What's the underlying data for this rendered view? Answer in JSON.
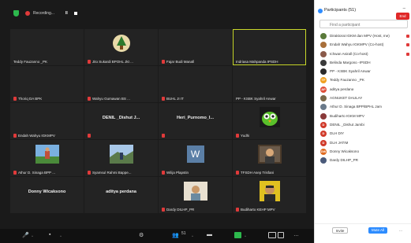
{
  "topbar": {
    "recording_label": "Recording...",
    "pause_label": "II"
  },
  "tiles": [
    {
      "name": "Teddy Fauzanno _PK",
      "mic_muted": false,
      "center": ""
    },
    {
      "name": "Jito Sukardi BPOHL Jkt ...",
      "mic_muted": true,
      "center": ""
    },
    {
      "name": "Fajar Budi Manafi",
      "mic_muted": true,
      "center": ""
    },
    {
      "name": "Indriasa Mahpanda IPSDH",
      "mic_muted": false,
      "center": ""
    },
    {
      "name": "Thoriq DA BPK",
      "mic_muted": true,
      "center": ""
    },
    {
      "name": "Wahyu Gumawan BS ...",
      "mic_muted": true,
      "center": ""
    },
    {
      "name": "BUHL JI IT",
      "mic_muted": true,
      "center": ""
    },
    {
      "name": "PP - KSBK Syahril Anwar",
      "mic_muted": false,
      "center": ""
    },
    {
      "name": "Endah Wahyu IGKMPV",
      "mic_muted": true,
      "center": ""
    },
    {
      "name": "",
      "mic_muted": true,
      "center": "DENIL _Dishut J..."
    },
    {
      "name": "",
      "mic_muted": true,
      "center": "Heri_Purnomo_I..."
    },
    {
      "name": "Yudhi",
      "mic_muted": true,
      "center": ""
    },
    {
      "name": "Athur D. Sinaga BPP ...",
      "mic_muted": true,
      "center": ""
    },
    {
      "name": "Syamsul Rahmi Bappe...",
      "mic_muted": true,
      "center": ""
    },
    {
      "name": "Wilija Plapstin",
      "mic_muted": true,
      "center": ""
    },
    {
      "name": "TFSDH Asep Trisfani",
      "mic_muted": true,
      "center": ""
    },
    {
      "name": "",
      "mic_muted": false,
      "center": "Donny Wicaksono"
    },
    {
      "name": "",
      "mic_muted": false,
      "center": "aditya perdana"
    },
    {
      "name": "Dardy DILHP_PR",
      "mic_muted": true,
      "center": ""
    },
    {
      "name": "Budiharto KEHP MPV",
      "mic_muted": true,
      "center": ""
    }
  ],
  "w_avatar": "W",
  "bottombar": {
    "participants_count": "51"
  },
  "panel": {
    "title": "Participants (51)",
    "search_placeholder": "Find a participant",
    "participants": [
      {
        "name": "Diraktorat IGKM dan MPV (Host, me)",
        "color": "#5a7a3a",
        "initial": ""
      },
      {
        "name": "Endah Wahyu IGKMPV (Co-host)",
        "color": "#a86f3a",
        "initial": ""
      },
      {
        "name": "Ichwan Asirall (Co-host)",
        "color": "#8a5a4a",
        "initial": ""
      },
      {
        "name": "Belinda Margono -IPSDH",
        "color": "#3a3a3a",
        "initial": ""
      },
      {
        "name": "PP - KSBK Syahril Anwar",
        "color": "#2a2a2a",
        "initial": ""
      },
      {
        "name": "Teddy Fauzanno _PK",
        "color": "#f0a020",
        "initial": "TF"
      },
      {
        "name": "aditya perdana",
        "color": "#e0503a",
        "initial": "AP"
      },
      {
        "name": "AGNUKET DAULAY",
        "color": "#7a6a4a",
        "initial": ""
      },
      {
        "name": "Athur D. Sinaga BPP/BPHL Jam",
        "color": "#6a7a8a",
        "initial": ""
      },
      {
        "name": "Budiharto IGKM MPV",
        "color": "#8a3a3a",
        "initial": ""
      },
      {
        "name": "DENIL _Dishut Jambi",
        "color": "#d03a2a",
        "initial": "D"
      },
      {
        "name": "DLH DIY",
        "color": "#d03a2a",
        "initial": "D"
      },
      {
        "name": "DLH JATIM",
        "color": "#d03a2a",
        "initial": "D"
      },
      {
        "name": "Donny Wicaksono",
        "color": "#e06a20",
        "initial": "DW"
      },
      {
        "name": "Dardy DILHP_PR",
        "color": "#4a5a7a",
        "initial": ""
      }
    ],
    "invite_label": "Invite",
    "mute_all_label": "Mute All",
    "more_label": "...",
    "end_label": "End"
  }
}
